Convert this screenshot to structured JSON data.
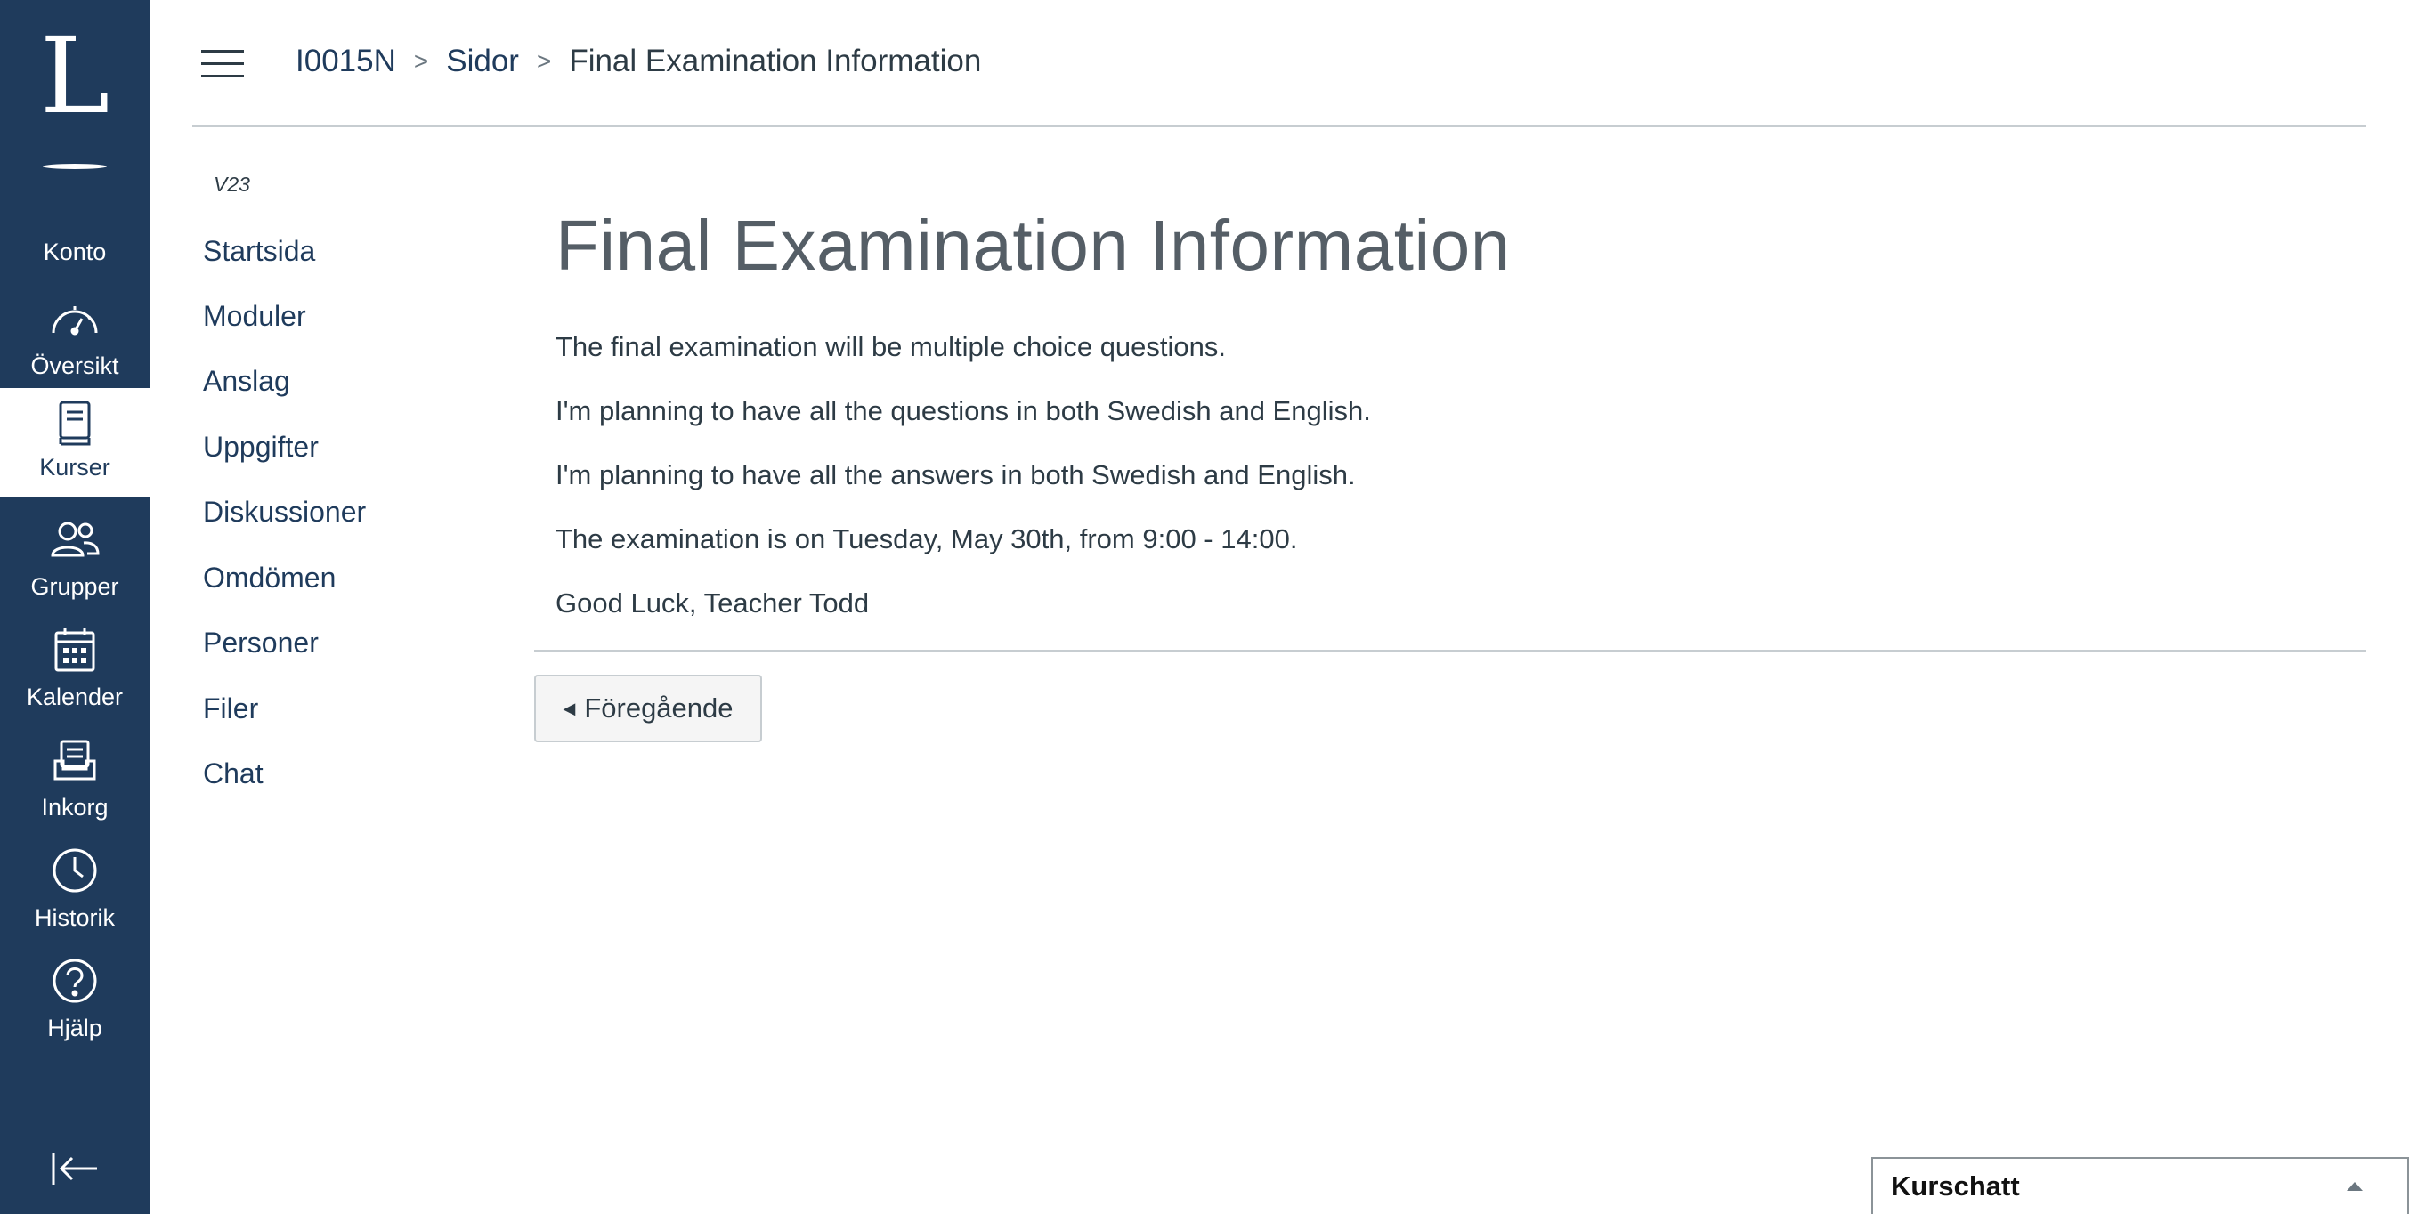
{
  "global_nav": {
    "logo": "L",
    "items": [
      {
        "label": "Konto",
        "icon": "avatar"
      },
      {
        "label": "Översikt",
        "icon": "dashboard-icon"
      },
      {
        "label": "Kurser",
        "icon": "courses-icon"
      },
      {
        "label": "Grupper",
        "icon": "groups-icon"
      },
      {
        "label": "Kalender",
        "icon": "calendar-icon"
      },
      {
        "label": "Inkorg",
        "icon": "inbox-icon"
      },
      {
        "label": "Historik",
        "icon": "history-icon"
      },
      {
        "label": "Hjälp",
        "icon": "help-icon"
      }
    ],
    "active_item": "Kurser",
    "collapse_icon": "collapse-nav-icon"
  },
  "breadcrumb": {
    "items": [
      "I0015N",
      "Sidor",
      "Final Examination Information"
    ]
  },
  "course_nav": {
    "term": "V23",
    "links": [
      "Startsida",
      "Moduler",
      "Anslag",
      "Uppgifter",
      "Diskussioner",
      "Omdömen",
      "Personer",
      "Filer",
      "Chat"
    ]
  },
  "page": {
    "title": "Final Examination Information",
    "paragraphs": [
      "The final examination will be multiple choice questions.",
      "I'm planning to have all the questions in both Swedish and English.",
      "I'm planning to have all the answers in both Swedish and English.",
      "The examination is on Tuesday, May 30th, from 9:00 - 14:00.",
      "Good Luck, Teacher Todd"
    ],
    "previous_button": "Föregående"
  },
  "chat_widget": {
    "title": "Kurschatt"
  },
  "colors": {
    "nav_background": "#1f3b5c",
    "link": "#1f3b5c",
    "text": "#2d3b45",
    "divider": "#c7cdd1"
  }
}
